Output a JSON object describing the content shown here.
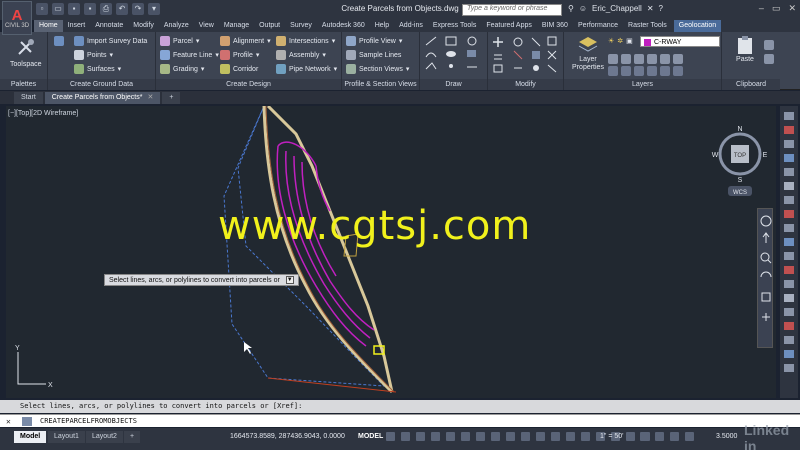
{
  "app": {
    "logo": "A",
    "logo_sub": "CIVIL 3D",
    "title": "Create Parcels from Objects.dwg"
  },
  "search": {
    "placeholder": "Type a keyword or phrase"
  },
  "user": {
    "name": "Eric_Chappell"
  },
  "ribbon_tabs": [
    "Home",
    "Insert",
    "Annotate",
    "Modify",
    "Analyze",
    "View",
    "Manage",
    "Output",
    "Survey",
    "Autodesk 360",
    "Help",
    "Add-ins",
    "Express Tools",
    "Featured Apps",
    "BIM 360",
    "Performance",
    "Raster Tools",
    "Geolocation"
  ],
  "panels": {
    "palettes": {
      "title": "Palettes",
      "toolspace": "Toolspace"
    },
    "ground": {
      "title": "Create Ground Data",
      "import_survey": "Import Survey Data",
      "points": "Points",
      "surfaces": "Surfaces"
    },
    "design": {
      "title": "Create Design",
      "parcel": "Parcel",
      "feature_line": "Feature Line",
      "grading": "Grading",
      "alignment": "Alignment",
      "profile": "Profile",
      "corridor": "Corridor",
      "intersections": "Intersections",
      "assembly": "Assembly",
      "pipe_network": "Pipe Network"
    },
    "profile_views": {
      "title": "Profile & Section Views",
      "profile_view": "Profile View",
      "sample_lines": "Sample Lines",
      "section_views": "Section Views"
    },
    "draw": {
      "title": "Draw"
    },
    "modify": {
      "title": "Modify"
    },
    "layers": {
      "title": "Layers",
      "layer_properties": "Layer Properties",
      "current_layer": "C-RWAY"
    },
    "clipboard": {
      "title": "Clipboard",
      "paste": "Paste"
    }
  },
  "file_tabs": {
    "start": "Start",
    "active": "Create Parcels from Objects*",
    "add": "+"
  },
  "viewport": {
    "label": "[−][Top][2D Wireframe]"
  },
  "tooltip": {
    "text": "Select lines, arcs, or polylines to convert into parcels or",
    "button": "▼"
  },
  "watermark": "www.cgtsj.com",
  "viewcube": {
    "n": "N",
    "s": "S",
    "e": "E",
    "w": "W",
    "top": "TOP",
    "wcs": "WCS"
  },
  "ucs": {
    "x": "X",
    "y": "Y"
  },
  "command": {
    "history": "Select lines, arcs, or polylines to convert into parcels or [Xref]:",
    "current": "CREATEPARCELFROMOBJECTS"
  },
  "layout_tabs": [
    "Model",
    "Layout1",
    "Layout2"
  ],
  "status": {
    "coords": "1664573.8589, 287436.9043, 0.0000",
    "model": "MODEL",
    "scale": "1\" = 50'",
    "zoom": "3.5000"
  },
  "linkedin": "Linked in",
  "colors": {
    "canvas": "#212830",
    "property_line": "#d8c89a",
    "parcel": "#c020c0",
    "boundary": "#4a78d0",
    "watermark": "#f1f11c"
  }
}
